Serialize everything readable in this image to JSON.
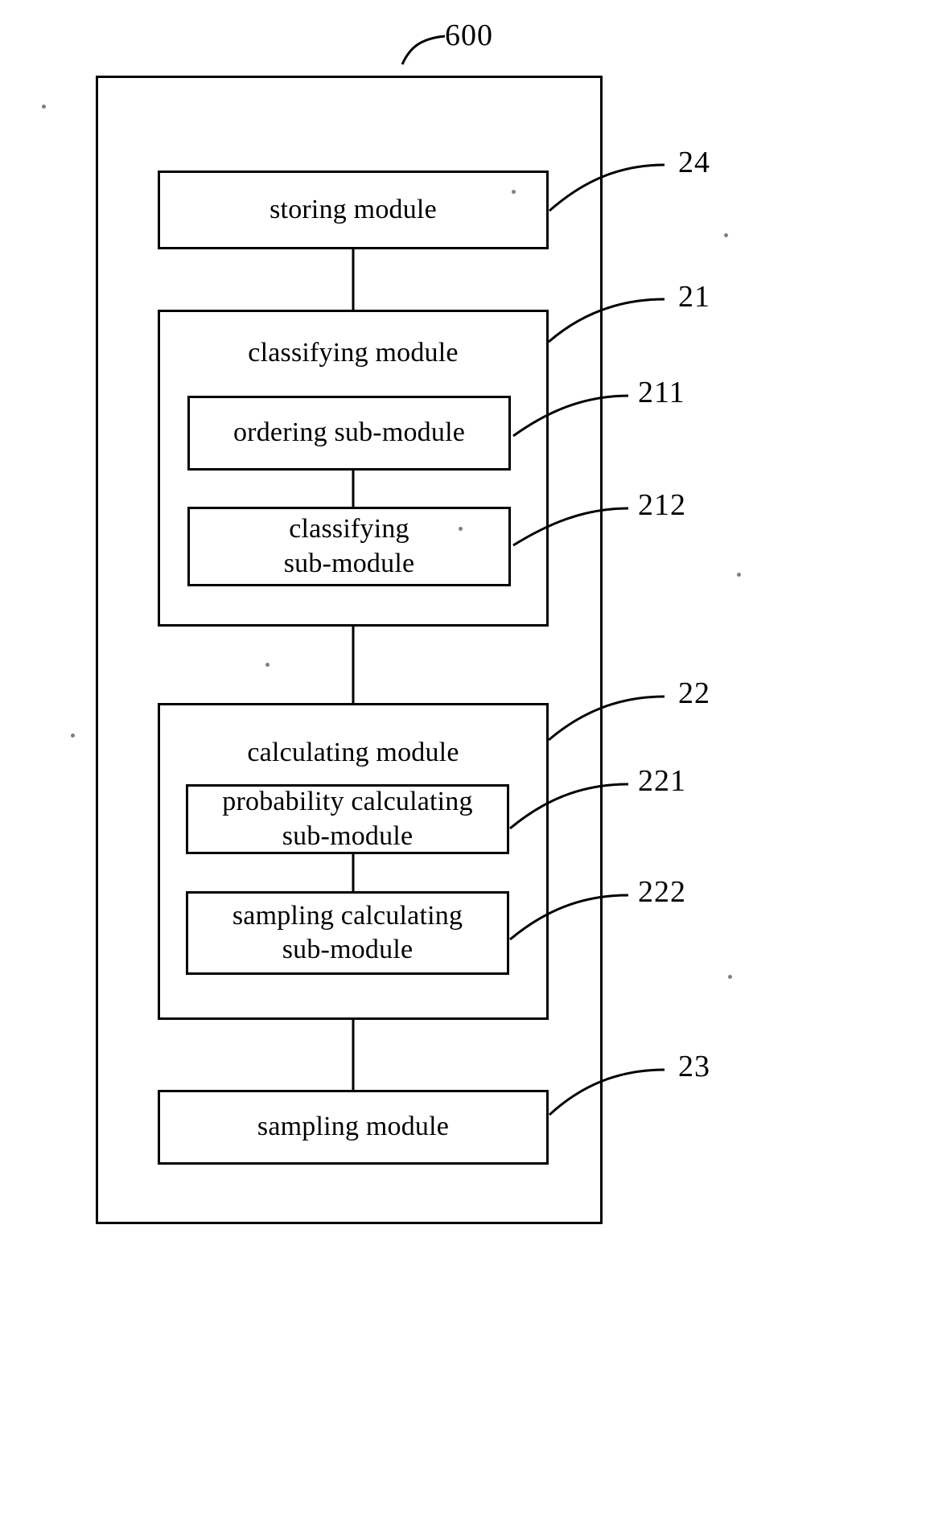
{
  "figure": {
    "figure_number": "600",
    "boxes": {
      "storing": "storing module",
      "classifying": "classifying module",
      "ordering_sub": "ordering sub-module",
      "classifying_sub": "classifying\nsub-module",
      "calculating": "calculating module",
      "probability_sub": "probability calculating\nsub-module",
      "sampling_sub": "sampling calculating\nsub-module",
      "sampling": "sampling module"
    },
    "reference_numerals": {
      "storing": "24",
      "classifying": "21",
      "ordering_sub": "211",
      "classifying_sub": "212",
      "calculating": "22",
      "probability_sub": "221",
      "sampling_sub": "222",
      "sampling": "23"
    }
  }
}
